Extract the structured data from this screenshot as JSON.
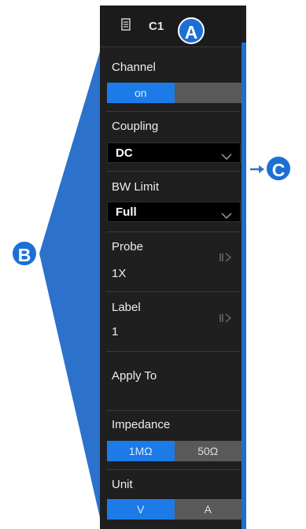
{
  "header": {
    "title": "C1",
    "icon": "document-icon"
  },
  "channel": {
    "label": "Channel",
    "on_label": "on",
    "off_label": "",
    "state": "on"
  },
  "coupling": {
    "label": "Coupling",
    "value": "DC"
  },
  "bw_limit": {
    "label": "BW Limit",
    "value": "Full"
  },
  "probe": {
    "label": "Probe",
    "value": "1X"
  },
  "label_field": {
    "label": "Label",
    "value": "1"
  },
  "apply_to": {
    "label": "Apply To"
  },
  "impedance": {
    "label": "Impedance",
    "options": [
      "1MΩ",
      "50Ω"
    ],
    "selected": "1MΩ"
  },
  "unit": {
    "label": "Unit",
    "options": [
      "V",
      "A"
    ],
    "selected": "V"
  },
  "callouts": {
    "a": "A",
    "b": "B",
    "c": "C"
  },
  "colors": {
    "accent": "#1c7be6",
    "panel": "#1f1f1f",
    "callout": "#1c6fd4"
  }
}
